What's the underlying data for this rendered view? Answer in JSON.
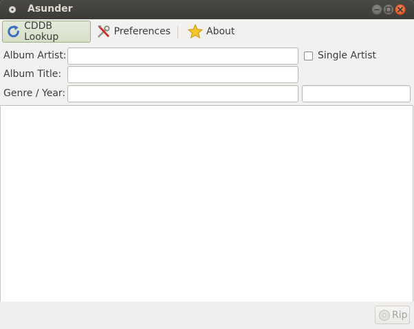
{
  "window": {
    "title": "Asunder"
  },
  "toolbar": {
    "cddb_label": "CDDB Lookup",
    "preferences_label": "Preferences",
    "about_label": "About"
  },
  "form": {
    "album_artist_label": "Album Artist:",
    "album_artist_value": "",
    "album_title_label": "Album Title:",
    "album_title_value": "",
    "genre_year_label": "Genre / Year:",
    "genre_value": "",
    "year_value": "",
    "single_artist_label": "Single Artist",
    "single_artist_checked": false
  },
  "bottom": {
    "rip_label": "Rip"
  },
  "colors": {
    "titlebar": "#3c3b37",
    "close_button": "#df4a16",
    "active_button": "#d6dfc9"
  }
}
